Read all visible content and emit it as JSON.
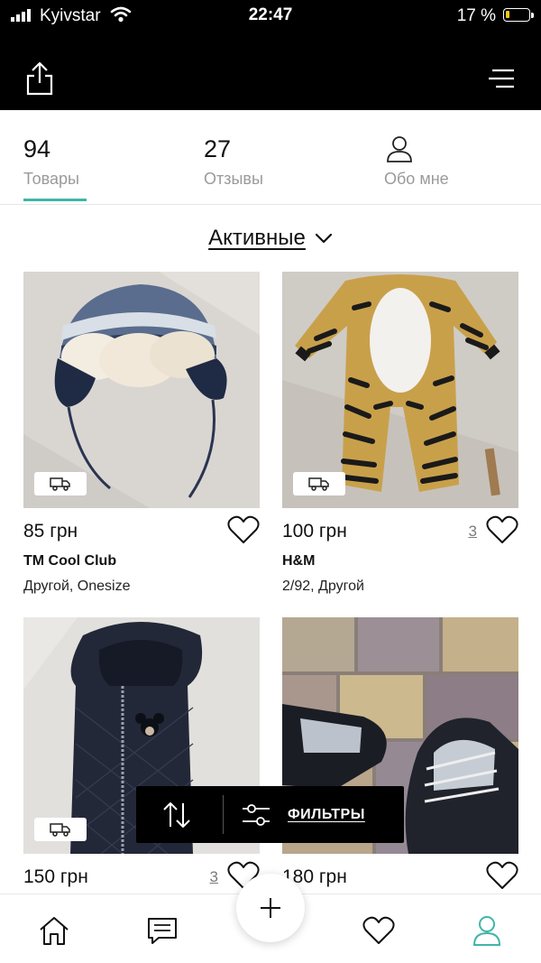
{
  "status_bar": {
    "carrier": "Kyivstar",
    "time": "22:47",
    "battery": "17 %"
  },
  "top_bar": {
    "share_icon": "share-icon",
    "menu_icon": "menu-icon"
  },
  "profile_tabs": {
    "products": {
      "count": "94",
      "label": "Товары",
      "active": true
    },
    "reviews": {
      "count": "27",
      "label": "Отзывы"
    },
    "about": {
      "label": "Обо мне",
      "icon": "user-icon"
    }
  },
  "status_filter": {
    "label": "Активные"
  },
  "products": [
    {
      "price": "85 грн",
      "likes": "",
      "brand": "TM Cool Club",
      "details": "Другой, Onesize",
      "image": "knit winter hat"
    },
    {
      "price": "100 грн",
      "likes": "3",
      "brand": "H&M",
      "details": "2/92, Другой",
      "image": "tiger costume"
    },
    {
      "price": "150 грн",
      "likes": "3",
      "brand": "",
      "details": "",
      "image": "quilted navy vest"
    },
    {
      "price": "180 грн",
      "likes": "",
      "brand": "",
      "details": "",
      "image": "ice skates"
    }
  ],
  "float_bar": {
    "sort_icon": "sort-icon",
    "filters_label": "ФИЛЬТРЫ"
  },
  "bottom_nav": [
    "home-icon",
    "messages-icon",
    "add-icon",
    "favorites-icon",
    "profile-icon"
  ],
  "colors": {
    "accent": "#3fb6a8",
    "header": "#000000"
  }
}
